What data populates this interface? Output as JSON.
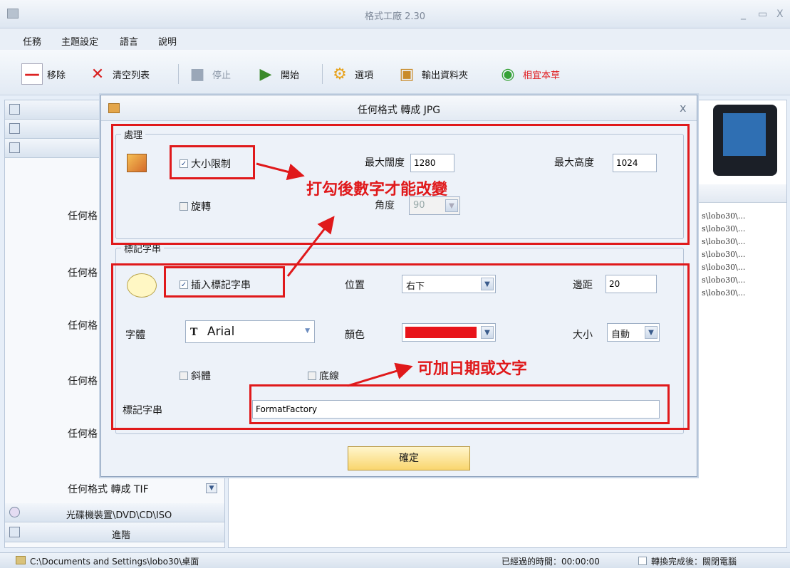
{
  "app": {
    "title": "格式工廠 2.30",
    "minimize": "_",
    "maximize": "▭",
    "close": "X"
  },
  "menu": [
    "任務",
    "主題設定",
    "語言",
    "說明"
  ],
  "toolbar": {
    "remove": "移除",
    "clear": "清空列表",
    "stop": "停止",
    "start": "開始",
    "options": "選項",
    "output_folder": "輸出資料夾",
    "recommend": "相宜本草"
  },
  "left_panel": {
    "items": [
      "任何格",
      "任何格",
      "任何格",
      "任何格",
      "任何格"
    ],
    "last_item": "任何格式 轉成 TIF",
    "dvd": "光碟機裝置\\DVD\\CD\\ISO",
    "advanced": "進階"
  },
  "file_list": [
    "s\\lobo30\\...",
    "s\\lobo30\\...",
    "s\\lobo30\\...",
    "s\\lobo30\\...",
    "s\\lobo30\\...",
    "s\\lobo30\\...",
    "s\\lobo30\\..."
  ],
  "status": {
    "path": "C:\\Documents and Settings\\lobo30\\桌面",
    "elapsed": "已經過的時間：00:00:00",
    "after_done": "轉換完成後：關閉電腦"
  },
  "dialog": {
    "title": "任何格式 轉成 JPG",
    "close": "x",
    "process_group": "處理",
    "size_limit": "大小限制",
    "max_width_label": "最大闊度",
    "max_width": "1280",
    "max_height_label": "最大高度",
    "max_height": "1024",
    "rotate": "旋轉",
    "angle_label": "角度",
    "angle": "90",
    "watermark_group": "標記字串",
    "insert_watermark": "插入標記字串",
    "position_label": "位置",
    "position": "右下",
    "margin_label": "邊距",
    "margin": "20",
    "font_label": "字體",
    "font": "Arial",
    "color_label": "顏色",
    "color": "#e8141a",
    "size_label": "大小",
    "size": "自動",
    "italic": "斜體",
    "underline": "底線",
    "text_label": "標記字串",
    "text_value": "FormatFactory",
    "ok": "確定"
  },
  "annotations": {
    "note1": "打勾後數字才能改變",
    "note2": "可加日期或文字"
  }
}
